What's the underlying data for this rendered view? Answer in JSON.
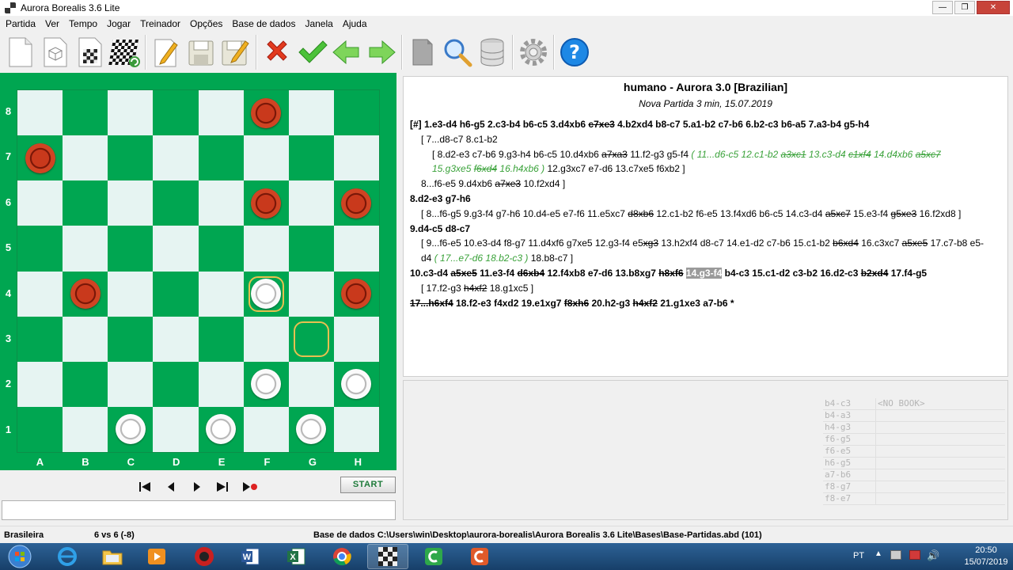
{
  "window": {
    "title": "Aurora Borealis 3.6 Lite"
  },
  "menu": [
    "Partida",
    "Ver",
    "Tempo",
    "Jogar",
    "Treinador",
    "Opções",
    "Base de dados",
    "Janela",
    "Ajuda"
  ],
  "board": {
    "files": [
      "A",
      "B",
      "C",
      "D",
      "E",
      "F",
      "G",
      "H"
    ],
    "ranks": [
      "8",
      "7",
      "6",
      "5",
      "4",
      "3",
      "2",
      "1"
    ],
    "pieces": {
      "F8": "red",
      "A7": "red",
      "F6": "red",
      "H6": "red",
      "B4": "red",
      "H4": "red",
      "F4": "white",
      "F2": "white",
      "H2": "white",
      "C1": "white",
      "E1": "white",
      "G1": "white"
    },
    "selected": [
      "F4",
      "G3"
    ]
  },
  "nav": {
    "start_label": "START"
  },
  "notation": {
    "header": "humano - Aurora 3.0 [Brazilian]",
    "subheader": "Nova Partida 3 min, 15.07.2019",
    "lines": [
      {
        "cls": "main",
        "segs": [
          [
            "n",
            "[#] 1.e3-d4 h6-g5 2.c3-b4 b6-c5 3.d4xb6 "
          ],
          [
            "s",
            "c7xe3"
          ],
          [
            "n",
            " 4.b2xd4 b8-c7 5.a1-b2 c7-b6 6.b2-c3 b6-a5 7.a3-b4 g5-h4"
          ]
        ]
      },
      {
        "cls": "v1",
        "segs": [
          [
            "n",
            "[ 7...d8-c7 8.c1-b2"
          ]
        ]
      },
      {
        "cls": "v2w",
        "segs": [
          [
            "n",
            "[ 8.d2-e3 c7-b6 9.g3-h4 b6-c5 10.d4xb6 "
          ],
          [
            "s",
            "a7xa3"
          ],
          [
            "n",
            " 11.f2-g3 g5-f4 "
          ],
          [
            "g",
            "( 11...d6-c5 12.c1-b2 "
          ],
          [
            "gs",
            "a3xc1"
          ],
          [
            "g",
            " 13.c3-d4 "
          ],
          [
            "gs",
            "c1xf4"
          ],
          [
            "g",
            " 14.d4xb6 "
          ],
          [
            "gs",
            "a5xc7"
          ],
          [
            "g",
            " 15.g3xe5 "
          ],
          [
            "gs",
            "f6xd4"
          ],
          [
            "g",
            " 16.h4xb6 )"
          ],
          [
            "n",
            " 12.g3xc7 e7-d6 13.c7xe5 f6xb2 ]"
          ]
        ]
      },
      {
        "cls": "v1",
        "segs": [
          [
            "n",
            "8...f6-e5 9.d4xb6 "
          ],
          [
            "s",
            "a7xe3"
          ],
          [
            "n",
            " 10.f2xd4 ]"
          ]
        ]
      },
      {
        "cls": "main",
        "segs": [
          [
            "n",
            "8.d2-e3 g7-h6"
          ]
        ]
      },
      {
        "cls": "v1",
        "segs": [
          [
            "n",
            "[ 8...f6-g5 9.g3-f4 g7-h6 10.d4-e5 e7-f6 11.e5xc7 "
          ],
          [
            "s",
            "d8xb6"
          ],
          [
            "n",
            " 12.c1-b2 f6-e5 13.f4xd6 b6-c5 14.c3-d4 "
          ],
          [
            "s",
            "a5xc7"
          ],
          [
            "n",
            " 15.e3-f4 "
          ],
          [
            "s",
            "g5xe3"
          ],
          [
            "n",
            " 16.f2xd8 ]"
          ]
        ]
      },
      {
        "cls": "main",
        "segs": [
          [
            "n",
            "9.d4-c5 d8-c7"
          ]
        ]
      },
      {
        "cls": "v1w",
        "segs": [
          [
            "n",
            "[ 9...f6-e5 10.e3-d4 f8-g7 11.d4xf6 g7xe5 12.g3-f4 e5"
          ],
          [
            "s",
            "xg3"
          ],
          [
            "n",
            " 13.h2xf4 d8-c7 14.e1-d2 c7-b6 15.c1-b2 "
          ],
          [
            "s",
            "b6xd4"
          ],
          [
            "n",
            " 16.c3xc7 "
          ],
          [
            "s",
            "a5xe5"
          ],
          [
            "n",
            " 17.c7-b8 e5-d4 "
          ],
          [
            "g",
            "( 17...e7-d6 18.b2-c3 )"
          ],
          [
            "n",
            " 18.b8-c7 ]"
          ]
        ]
      },
      {
        "cls": "main",
        "segs": [
          [
            "n",
            "10.c3-d4 "
          ],
          [
            "s",
            "a5xe5"
          ],
          [
            "n",
            " 11.e3-f4 "
          ],
          [
            "s",
            "d6xb4"
          ],
          [
            "n",
            " 12.f4xb8 e7-d6 13.b8xg7 "
          ],
          [
            "s",
            "h8xf6"
          ],
          [
            "n",
            " "
          ],
          [
            "h",
            "14.g3-f4"
          ],
          [
            "n",
            " b4-c3 15.c1-d2 c3-b2 16.d2-c3 "
          ],
          [
            "s",
            "b2xd4"
          ],
          [
            "n",
            " 17.f4-g5"
          ]
        ]
      },
      {
        "cls": "v1",
        "segs": [
          [
            "n",
            "[ 17.f2-g3 "
          ],
          [
            "s",
            "h4xf2"
          ],
          [
            "n",
            " 18.g1xc5 ]"
          ]
        ]
      },
      {
        "cls": "main",
        "segs": [
          [
            "s",
            "17...h6xf4"
          ],
          [
            "n",
            " 18.f2-e3 f4xd2 19.e1xg7 "
          ],
          [
            "s",
            "f8xh6"
          ],
          [
            "n",
            " 20.h2-g3 "
          ],
          [
            "s",
            "h4xf2"
          ],
          [
            "n",
            " 21.g1xe3 a7-b6  *"
          ]
        ]
      }
    ]
  },
  "book": {
    "header": "<NO BOOK>",
    "moves": [
      "b4-c3",
      "b4-a3",
      "h4-g3",
      "f6-g5",
      "f6-e5",
      "h6-g5",
      "a7-b6",
      "f8-g7",
      "f8-e7"
    ]
  },
  "status": {
    "variant": "Brasileira",
    "score": "6 vs 6  (-8)",
    "database": "Base de dados C:\\Users\\win\\Desktop\\aurora-borealis\\Aurora Borealis 3.6 Lite\\Bases\\Base-Partidas.abd (101)"
  },
  "taskbar": {
    "lang": "PT",
    "time": "20:50",
    "date": "15/07/2019"
  },
  "colors": {
    "board_green": "#00a651",
    "board_light": "#e6f4f2",
    "variation_green": "#3aa23a"
  }
}
